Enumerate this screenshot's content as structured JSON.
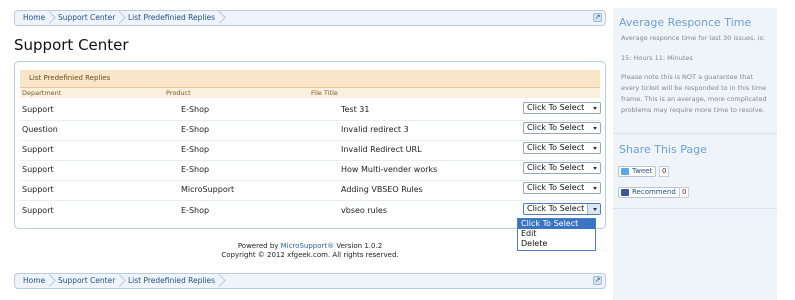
{
  "breadcrumb": {
    "items": [
      "Home",
      "Support Center",
      "List Predefinied Replies"
    ]
  },
  "page_title": "Support Center",
  "panel": {
    "title": "List Predefinied Replies",
    "columns": [
      "Department",
      "Product",
      "File Title"
    ],
    "rows": [
      {
        "department": "Support",
        "product": "E-Shop",
        "title": "Test 31",
        "action": "Click To Select"
      },
      {
        "department": "Question",
        "product": "E-Shop",
        "title": "Invalid redirect 3",
        "action": "Click To Select"
      },
      {
        "department": "Support",
        "product": "E-Shop",
        "title": "Invalid Redirect URL",
        "action": "Click To Select"
      },
      {
        "department": "Support",
        "product": "E-Shop",
        "title": "How Multi-vender works",
        "action": "Click To Select"
      },
      {
        "department": "Support",
        "product": "MicroSupport",
        "title": "Adding VBSEO Rules",
        "action": "Click To Select"
      },
      {
        "department": "Support",
        "product": "E-Shop",
        "title": "vbseo rules",
        "action": "Click To Select"
      }
    ],
    "dropdown_options": [
      "Click To Select",
      "Edit",
      "Delete"
    ]
  },
  "footer": {
    "powered_prefix": "Powered by ",
    "product_link": "MicroSupport®",
    "version": " Version 1.0.2",
    "copyright": "Copyright © 2012 xfgeek.com. All rights reserved."
  },
  "sidebar": {
    "response_title": "Average Responce Time",
    "response_intro": "Average responce time for last 30 issues, is:",
    "response_value": "15: Hours  11: Minutes",
    "response_note": "Please note this is NOT a guarantee that every ticket will be responded to in this time frame. This is an average, more complicated problems may require more time to resolve.",
    "share_title": "Share This Page",
    "tweet_label": "Tweet",
    "tweet_count": "0",
    "recommend_label": "Recommend",
    "recommend_count": "0"
  },
  "colors": {
    "link": "#23538a",
    "panel_header": "#f9e5c8",
    "sidebar_title": "#6fa0d6",
    "selected_option": "#3a75c4"
  }
}
